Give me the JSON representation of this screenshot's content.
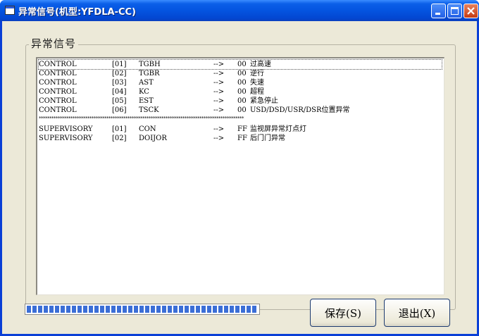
{
  "window": {
    "title": "异常信号(机型:YFDLA-CC)"
  },
  "group": {
    "label": "异常信号"
  },
  "list": {
    "rows": [
      {
        "col1": "CONTROL",
        "col2": "[01]",
        "col3": "TGBH",
        "col4": "-->",
        "col5": "00",
        "col6": "过高速"
      },
      {
        "col1": "CONTROL",
        "col2": "[02]",
        "col3": "TGBR",
        "col4": "-->",
        "col5": "00",
        "col6": "逆行"
      },
      {
        "col1": "CONTROL",
        "col2": "[03]",
        "col3": "AST",
        "col4": "-->",
        "col5": "00",
        "col6": "失速"
      },
      {
        "col1": "CONTROL",
        "col2": "[04]",
        "col3": "KC",
        "col4": "-->",
        "col5": "00",
        "col6": "超程"
      },
      {
        "col1": "CONTROL",
        "col2": "[05]",
        "col3": "EST",
        "col4": "-->",
        "col5": "00",
        "col6": "紧急停止"
      },
      {
        "col1": "CONTROL",
        "col2": "[06]",
        "col3": "TSCK",
        "col4": "-->",
        "col5": "00",
        "col6": "USD/DSD/USR/DSR位置异常"
      }
    ],
    "separator": "*************************************************************************************************",
    "rows2": [
      {
        "col1": "SUPERVISORY",
        "col2": "[01]",
        "col3": "CON",
        "col4": "-->",
        "col5": "FF",
        "col6": "监视屏异常灯点灯"
      },
      {
        "col1": "SUPERVISORY",
        "col2": "[02]",
        "col3": "DOIJOR",
        "col4": "-->",
        "col5": "FF",
        "col6": "后门门异常"
      }
    ]
  },
  "progress": {
    "value": 1.0
  },
  "buttons": {
    "save": "保存(S)",
    "exit": "退出(X)"
  },
  "icons": {
    "app": "app-icon",
    "minimize": "minimize-icon",
    "maximize": "maximize-icon",
    "close": "close-icon"
  }
}
